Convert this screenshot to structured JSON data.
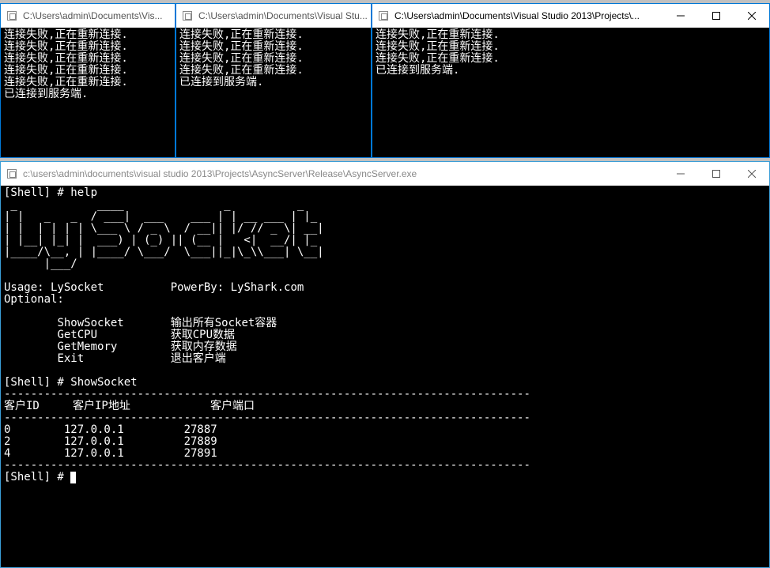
{
  "client_windows": [
    {
      "title": "C:\\Users\\admin\\Documents\\Vis...",
      "lines": [
        "连接失败,正在重新连接.",
        "连接失败,正在重新连接.",
        "连接失败,正在重新连接.",
        "连接失败,正在重新连接.",
        "连接失败,正在重新连接.",
        "已连接到服务端."
      ]
    },
    {
      "title": "C:\\Users\\admin\\Documents\\Visual Stu...",
      "lines": [
        "连接失败,正在重新连接.",
        "连接失败,正在重新连接.",
        "连接失败,正在重新连接.",
        "连接失败,正在重新连接.",
        "已连接到服务端."
      ]
    },
    {
      "title": "C:\\Users\\admin\\Documents\\Visual Studio 2013\\Projects\\...",
      "lines": [
        "连接失败,正在重新连接.",
        "连接失败,正在重新连接.",
        "连接失败,正在重新连接.",
        "已连接到服务端."
      ]
    }
  ],
  "server": {
    "title": "c:\\users\\admin\\documents\\visual studio 2013\\Projects\\AsyncServer\\Release\\AsyncServer.exe",
    "prompt": "[Shell] # ",
    "cmd_help": "help",
    "cmd_show": "ShowSocket",
    "ascii_art": " _            ____               _          _   \n| |   _   _  / ___|  ___    ___ | | __ ___ | |_ \n| |  | | | | \\___ \\ / _ \\  / __|| |/ // _ \\| __|\n| |__| |_| |  ___) | (_) || (__ |   <|  __/| |_ \n|____/\\__, | |____/ \\___/  \\___||_|\\_\\\\___| \\__|\n      |___/                                     ",
    "usage": "Usage: LySocket \t PowerBy: LyShark.com",
    "optional": "Optional:",
    "options": [
      {
        "cmd": "ShowSocket",
        "desc": "输出所有Socket容器"
      },
      {
        "cmd": "GetCPU",
        "desc": "获取CPU数据"
      },
      {
        "cmd": "GetMemory",
        "desc": "获取内存数据"
      },
      {
        "cmd": "Exit",
        "desc": "退出客户端"
      }
    ],
    "sep": "-------------------------------------------------------------------------------",
    "table_header": {
      "c1": "客户ID",
      "c2": "客户IP地址",
      "c3": "客户端口"
    },
    "rows": [
      {
        "id": "0",
        "ip": "127.0.0.1",
        "port": "27887"
      },
      {
        "id": "2",
        "ip": "127.0.0.1",
        "port": "27889"
      },
      {
        "id": "4",
        "ip": "127.0.0.1",
        "port": "27891"
      }
    ]
  },
  "winctl": {
    "min": "minimize",
    "max": "maximize",
    "close": "close"
  }
}
